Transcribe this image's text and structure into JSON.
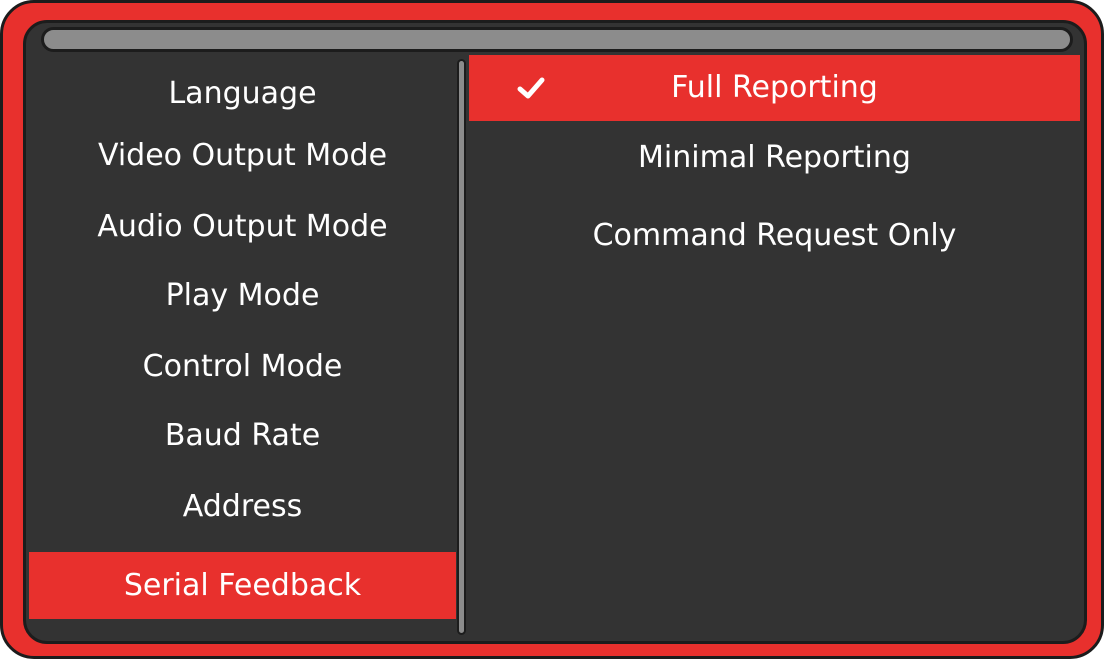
{
  "menu": {
    "items": [
      {
        "label": "Language",
        "selected": false
      },
      {
        "label": "Video Output Mode",
        "selected": false
      },
      {
        "label": "Audio Output Mode",
        "selected": false
      },
      {
        "label": "Play Mode",
        "selected": false
      },
      {
        "label": "Control Mode",
        "selected": false
      },
      {
        "label": "Baud Rate",
        "selected": false
      },
      {
        "label": "Address",
        "selected": false
      },
      {
        "label": "Serial Feedback",
        "selected": true
      }
    ]
  },
  "options": {
    "items": [
      {
        "label": "Full Reporting",
        "selected": true,
        "icon": "check-icon"
      },
      {
        "label": "Minimal Reporting",
        "selected": false
      },
      {
        "label": "Command Request Only",
        "selected": false
      }
    ]
  },
  "colors": {
    "accent": "#e8302d",
    "panel": "#333333",
    "bar": "#8c8c8c",
    "outline": "#1c1c1c",
    "text": "#ffffff"
  }
}
